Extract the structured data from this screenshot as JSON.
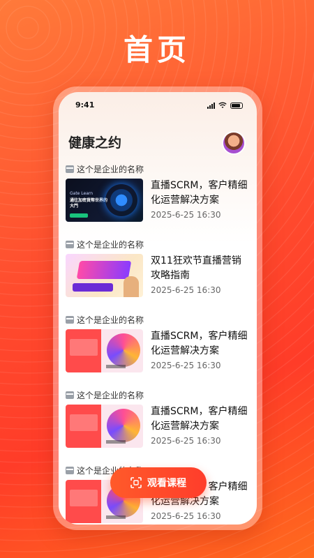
{
  "headline": "首页",
  "status": {
    "time": "9:41"
  },
  "app": {
    "title": "健康之约"
  },
  "items": [
    {
      "company": "这个是企业的名称",
      "title": "直播SCRM，客户精细化运营解决方案",
      "time": "2025-6-25 16:30",
      "thumb_title": "Gate Learn",
      "thumb_sub": "通往加密貨幣世界的大門"
    },
    {
      "company": "这个是企业的名称",
      "title": "双11狂欢节直播营销攻略指南",
      "time": "2025-6-25 16:30"
    },
    {
      "company": "这个是企业的名称",
      "title": "直播SCRM，客户精细化运营解决方案",
      "time": "2025-6-25 16:30"
    },
    {
      "company": "这个是企业的名称",
      "title": "直播SCRM，客户精细化运营解决方案",
      "time": "2025-6-25 16:30"
    },
    {
      "company": "这个是企业的名称",
      "title": "直播SCRM，客户精细化运营解决方案",
      "time": "2025-6-25 16:30"
    }
  ],
  "cta": {
    "label": "观看课程"
  }
}
